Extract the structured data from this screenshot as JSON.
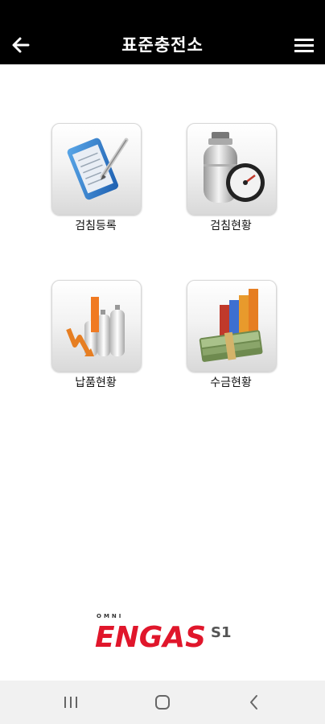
{
  "header": {
    "title": "표준충전소",
    "back_icon": "back-arrow-icon",
    "menu_icon": "hamburger-menu-icon",
    "background": "#000000"
  },
  "menu": [
    {
      "label": "검침등록",
      "icon": "meter-reading-register-icon"
    },
    {
      "label": "검침현황",
      "icon": "gas-cylinder-gauge-icon"
    },
    {
      "label": "납품현황",
      "icon": "delivery-cylinders-chart-icon"
    },
    {
      "label": "수금현황",
      "icon": "money-bar-chart-icon"
    }
  ],
  "brand": {
    "tagline": "OMNI",
    "name": "ENGAS",
    "suffix": "S1",
    "color": "#e0162b"
  },
  "nav": {
    "recent_icon": "recent-apps-icon",
    "home_icon": "home-icon",
    "back_icon": "back-icon"
  }
}
